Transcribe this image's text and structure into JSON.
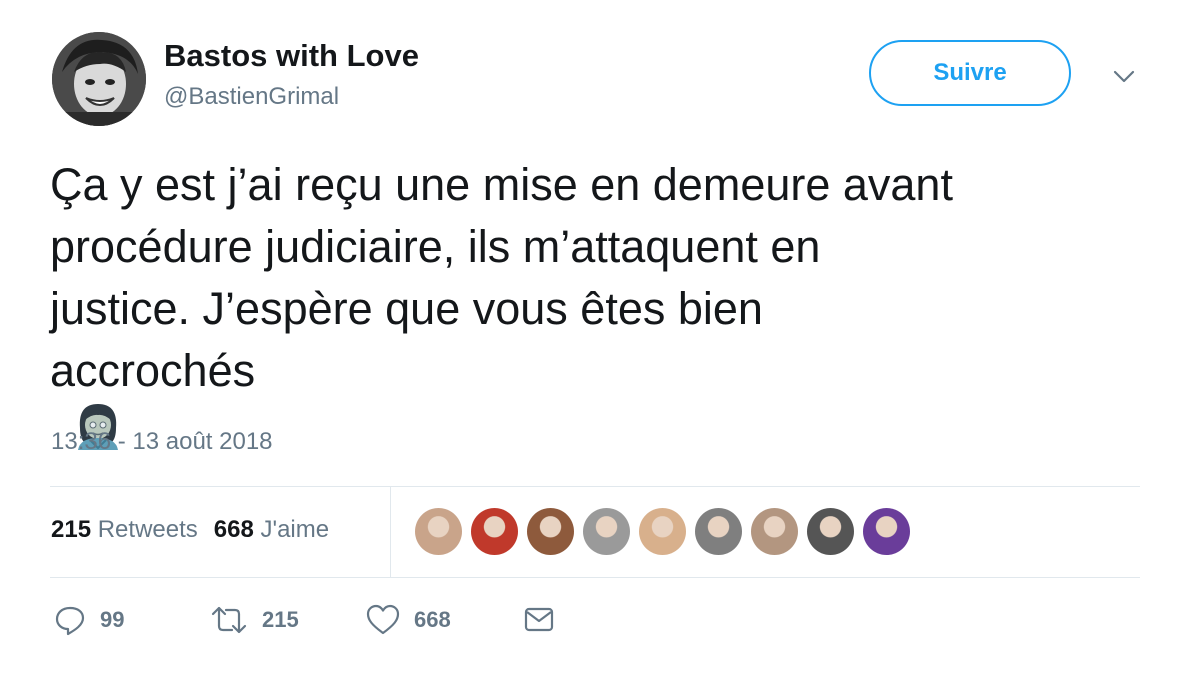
{
  "user": {
    "display_name": "Bastos with Love",
    "handle": "@BastienGrimal"
  },
  "follow_button": {
    "label": "Suivre"
  },
  "menu": {
    "icon": "chevron-down-icon"
  },
  "tweet": {
    "lines": [
      "Ça y est j’ai reçu une mise en demeure avant",
      "procédure judiciaire, ils m’attaquent en",
      "justice. J’espère que vous êtes bien",
      "accrochés"
    ],
    "emoji": "zombie-woman-emoji",
    "timestamp": "13:36 - 13 août 2018"
  },
  "stats": {
    "retweets_count": "215",
    "retweets_label": "Retweets",
    "likes_count": "668",
    "likes_label": "J'aime"
  },
  "likers": [
    {
      "color": "#c9a48a"
    },
    {
      "color": "#c0392b"
    },
    {
      "color": "#8e5a3c"
    },
    {
      "color": "#9a9a9a"
    },
    {
      "color": "#d8b08c"
    },
    {
      "color": "#7f7f7f"
    },
    {
      "color": "#b39680"
    },
    {
      "color": "#555555"
    },
    {
      "color": "#6a3d9a"
    }
  ],
  "actions": {
    "reply": {
      "icon": "reply-icon",
      "count": "99"
    },
    "retweet": {
      "icon": "retweet-icon",
      "count": "215"
    },
    "like": {
      "icon": "heart-icon",
      "count": "668"
    },
    "message": {
      "icon": "envelope-icon"
    }
  },
  "colors": {
    "accent": "#1da1f2",
    "secondary_text": "#657786",
    "divider": "#e1e8ed"
  }
}
